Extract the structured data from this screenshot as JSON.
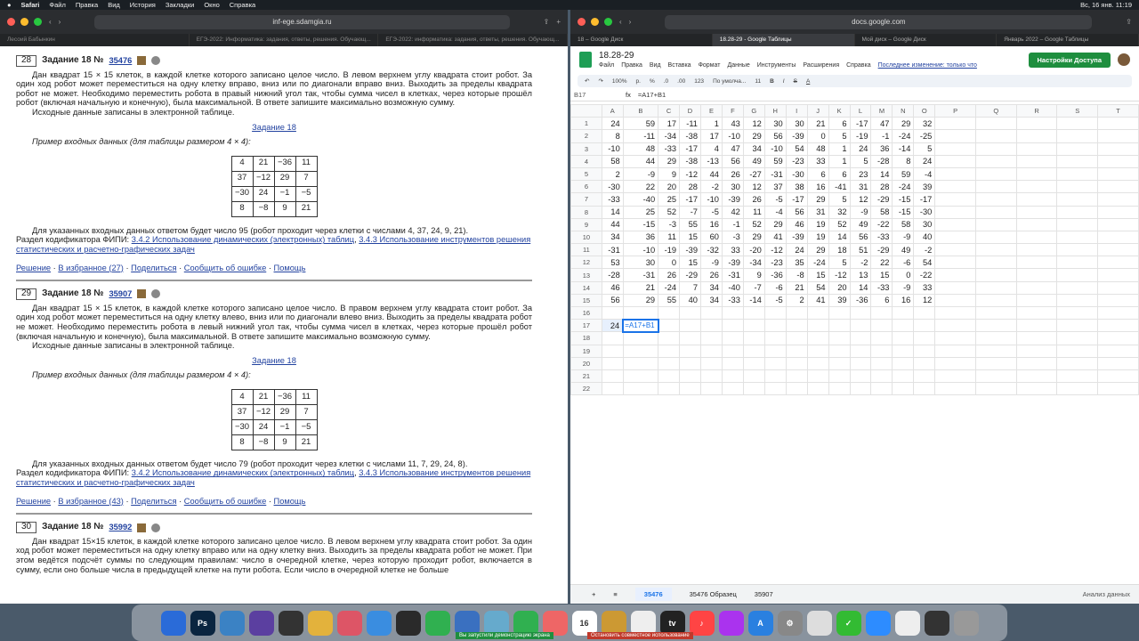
{
  "menubar": {
    "app": "Safari",
    "items": [
      "Файл",
      "Правка",
      "Вид",
      "История",
      "Закладки",
      "Окно",
      "Справка"
    ],
    "clock": "Вс, 16 янв. 11:19"
  },
  "left": {
    "url": "inf-ege.sdamgia.ru",
    "tabs": [
      "Лесоий Бабынкин",
      "ЕГЭ-2022: Информатика: задания, ответы, решения. Обучающ...",
      "ЕГЭ-2022: информатика: задания, ответы, решения. Обучающ..."
    ],
    "tasks": [
      {
        "num": "28",
        "title": "Задание 18 №",
        "id": "35476",
        "text": "Дан квадрат 15 × 15 клеток, в каждой клетке которого записано целое число. В левом верхнем углу квадрата стоит робот. За один ход робот может переместиться на одну клетку вправо, вниз или по диагонали вправо вниз. Выходить за пределы квадрата робот не может. Необходимо переместить робота в правый нижний угол так, чтобы сумма чисел в клетках, через которые прошёл робот (включая начальную и конечную), была максимальной. В ответе запишите максимально возможную сумму.",
        "src": "Исходные данные записаны в электронной таблице.",
        "link": "Задание 18",
        "example": "Пример входных данных (для таблицы размером 4 × 4):",
        "grid": [
          [
            "4",
            "21",
            "−36",
            "11"
          ],
          [
            "37",
            "−12",
            "29",
            "7"
          ],
          [
            "−30",
            "24",
            "−1",
            "−5"
          ],
          [
            "8",
            "−8",
            "9",
            "21"
          ]
        ],
        "answer": "Для указанных входных данных ответом будет число 95 (робот проходит через клетки с числами 4, 37, 24, 9, 21).",
        "codifier": "Раздел кодификатора ФИПИ:",
        "cod1": "3.4.2 Использование динамических (электронных) таблиц",
        "cod2": "3.4.3 Использование инструментов решения статистических и расчетно-графических задач",
        "actions": [
          "Решение",
          "В избранное (27)",
          "Поделиться",
          "Сообщить об ошибке",
          "Помощь"
        ]
      },
      {
        "num": "29",
        "title": "Задание 18 №",
        "id": "35907",
        "text": "Дан квадрат 15 × 15 клеток, в каждой клетке которого записано целое число. В правом верхнем углу квадрата стоит робот. За один ход робот может переместиться на одну клетку влево, вниз или по диагонали влево вниз. Выходить за пределы квадрата робот не может. Необходимо переместить робота в левый нижний угол так, чтобы сумма чисел в клетках, через которые прошёл робот (включая начальную и конечную), была максимальной. В ответе запишите максимально возможную сумму.",
        "src": "Исходные данные записаны в электронной таблице.",
        "link": "Задание 18",
        "example": "Пример входных данных (для таблицы размером 4 × 4):",
        "grid": [
          [
            "4",
            "21",
            "−36",
            "11"
          ],
          [
            "37",
            "−12",
            "29",
            "7"
          ],
          [
            "−30",
            "24",
            "−1",
            "−5"
          ],
          [
            "8",
            "−8",
            "9",
            "21"
          ]
        ],
        "answer": "Для указанных входных данных ответом будет число 79 (робот проходит через клетки с числами 11, 7, 29, 24, 8).",
        "codifier": "Раздел кодификатора ФИПИ:",
        "cod1": "3.4.2 Использование динамических (электронных) таблиц",
        "cod2": "3.4.3 Использование инструментов решения статистических и расчетно-графических задач",
        "actions": [
          "Решение",
          "В избранное (43)",
          "Поделиться",
          "Сообщить об ошибке",
          "Помощь"
        ]
      }
    ],
    "task30": {
      "num": "30",
      "title": "Задание 18 №",
      "id": "35992",
      "text": "Дан квадрат 15×15 клеток, в каждой клетке которого записано целое число. В левом верхнем углу квадрата стоит робот. За один ход робот может переместиться на одну клетку вправо или на одну клетку вниз. Выходить за пределы квадрата робот не может. При этом ведётся подсчёт суммы по следующим правилам: число в очередной клетке, через которую проходит робот, включается в сумму, если оно больше числа в предыдущей клетке на пути робота. Если число в очередной клетке не больше"
    }
  },
  "right": {
    "url": "docs.google.com",
    "tabs": [
      "18 – Google Диск",
      "18.28-29 - Google Таблицы",
      "Мой диск – Google Диск",
      "Январь 2022 – Google Таблицы"
    ],
    "title": "18.28-29",
    "menu": [
      "Файл",
      "Правка",
      "Вид",
      "Вставка",
      "Формат",
      "Данные",
      "Инструменты",
      "Расширения",
      "Справка"
    ],
    "lastedit": "Последнее изменение: только что",
    "share": "Настройки Доступа",
    "toolbar": [
      "100%",
      "р.",
      "%",
      ".0",
      ".00",
      "123",
      "По умолча...",
      "11",
      "B",
      "I",
      "S",
      "A"
    ],
    "cellref": "B17",
    "formula": "=A17+B1",
    "cols": [
      "A",
      "B",
      "C",
      "D",
      "E",
      "F",
      "G",
      "H",
      "I",
      "J",
      "K",
      "L",
      "M",
      "N",
      "O",
      "P",
      "Q",
      "R",
      "S",
      "T"
    ],
    "rows": [
      [
        "24",
        "59",
        "17",
        "-11",
        "1",
        "43",
        "12",
        "30",
        "30",
        "21",
        "6",
        "-17",
        "47",
        "29",
        "32"
      ],
      [
        "8",
        "-11",
        "-34",
        "-38",
        "17",
        "-10",
        "29",
        "56",
        "-39",
        "0",
        "5",
        "-19",
        "-1",
        "-24",
        "-25"
      ],
      [
        "-10",
        "48",
        "-33",
        "-17",
        "4",
        "47",
        "34",
        "-10",
        "54",
        "48",
        "1",
        "24",
        "36",
        "-14",
        "5"
      ],
      [
        "58",
        "44",
        "29",
        "-38",
        "-13",
        "56",
        "49",
        "59",
        "-23",
        "33",
        "1",
        "5",
        "-28",
        "8",
        "24"
      ],
      [
        "2",
        "-9",
        "9",
        "-12",
        "44",
        "26",
        "-27",
        "-31",
        "-30",
        "6",
        "6",
        "23",
        "14",
        "59",
        "-4"
      ],
      [
        "-30",
        "22",
        "20",
        "28",
        "-2",
        "30",
        "12",
        "37",
        "38",
        "16",
        "-41",
        "31",
        "28",
        "-24",
        "39"
      ],
      [
        "-33",
        "-40",
        "25",
        "-17",
        "-10",
        "-39",
        "26",
        "-5",
        "-17",
        "29",
        "5",
        "12",
        "-29",
        "-15",
        "-17"
      ],
      [
        "14",
        "25",
        "52",
        "-7",
        "-5",
        "42",
        "11",
        "-4",
        "56",
        "31",
        "32",
        "-9",
        "58",
        "-15",
        "-30"
      ],
      [
        "44",
        "-15",
        "-3",
        "55",
        "16",
        "-1",
        "52",
        "29",
        "46",
        "19",
        "52",
        "49",
        "-22",
        "58",
        "30"
      ],
      [
        "34",
        "36",
        "11",
        "15",
        "60",
        "-3",
        "29",
        "41",
        "-39",
        "19",
        "14",
        "56",
        "-33",
        "-9",
        "40"
      ],
      [
        "-31",
        "-10",
        "-19",
        "-39",
        "-32",
        "33",
        "-20",
        "-12",
        "24",
        "29",
        "18",
        "51",
        "-29",
        "49",
        "-2"
      ],
      [
        "53",
        "30",
        "0",
        "15",
        "-9",
        "-39",
        "-34",
        "-23",
        "35",
        "-24",
        "5",
        "-2",
        "22",
        "-6",
        "54"
      ],
      [
        "-28",
        "-31",
        "26",
        "-29",
        "26",
        "-31",
        "9",
        "-36",
        "-8",
        "15",
        "-12",
        "13",
        "15",
        "0",
        "-22"
      ],
      [
        "46",
        "21",
        "-24",
        "7",
        "34",
        "-40",
        "-7",
        "-6",
        "21",
        "54",
        "20",
        "14",
        "-33",
        "-9",
        "33"
      ],
      [
        "56",
        "29",
        "55",
        "40",
        "34",
        "-33",
        "-14",
        "-5",
        "2",
        "41",
        "39",
        "-36",
        "6",
        "16",
        "12"
      ]
    ],
    "row17": {
      "a": "24",
      "b": "=A17+B1"
    },
    "sheets": [
      "35476",
      "35476 Образец",
      "35907"
    ],
    "explore": "Анализ данных"
  },
  "dock": {
    "notice1": "Вы запустили демонстрацию экрана",
    "notice2": "Остановить совместное использование"
  }
}
